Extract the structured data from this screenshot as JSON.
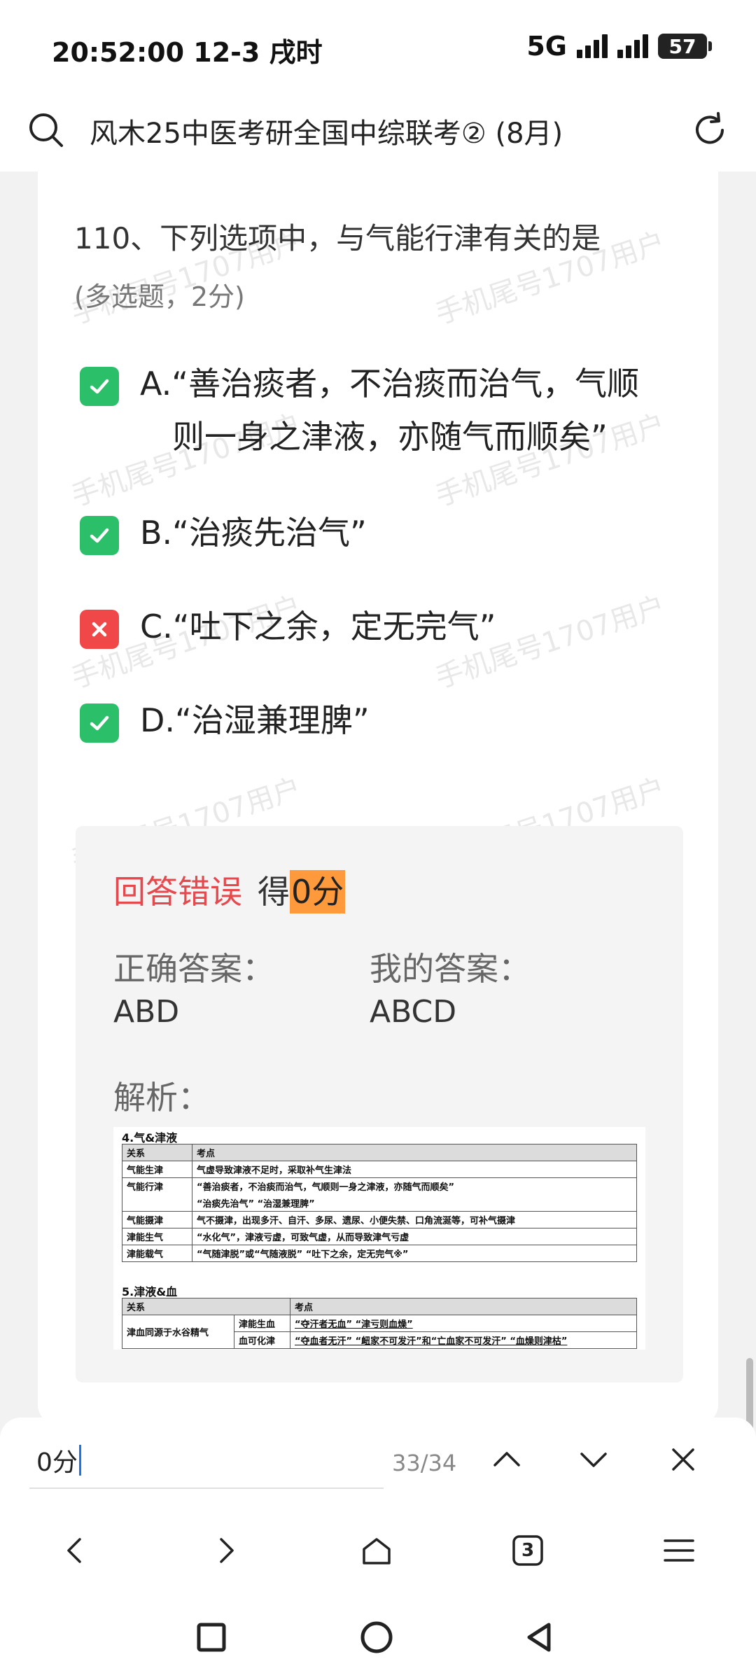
{
  "status_bar": {
    "time": "20:52:00 12-3 戌时",
    "network": "5G",
    "battery": "57"
  },
  "top_bar": {
    "title": "风木25中医考研全国中综联考② (8月)"
  },
  "watermark": "手机尾号1707用户",
  "question": {
    "title": "110、下列选项中，与气能行津有关的是",
    "subtitle": "(多选题，2分)",
    "options": [
      {
        "line1": "A.“善治痰者，不治痰而治气，气顺",
        "line2": "则一身之津液，亦随气而顺矣”",
        "state": "correct"
      },
      {
        "line1": "B.“治痰先治气”",
        "state": "correct"
      },
      {
        "line1": "C.“吐下之余，定无完气”",
        "state": "wrong"
      },
      {
        "line1": "D.“治湿兼理脾”",
        "state": "correct"
      }
    ]
  },
  "answer": {
    "status": "回答错误",
    "score_prefix": "得",
    "score_value": "0分",
    "correct_label": "正确答案：",
    "correct_value": "ABD",
    "mine_label": "我的答案：",
    "mine_value": "ABCD",
    "analysis_label": "解析："
  },
  "analysis_table": {
    "section1": "4.气&津液",
    "header": [
      "关系",
      "考点"
    ],
    "rows": [
      [
        "气能生津",
        "气虚导致津液不足时，采取补气生津法"
      ],
      [
        "气能行津",
        "“善治痰者，不治痰而治气，气顺则一身之津液，亦随气而顺矣”"
      ],
      [
        "",
        "“治痰先治气”  “治湿兼理脾”"
      ],
      [
        "气能摄津",
        "气不摄津，出现多汗、自汗、多尿、遗尿、小便失禁、口角流涎等，可补气摄津"
      ],
      [
        "津能生气",
        "“水化气”，津液亏虚，可致气虚，从而导致津气亏虚"
      ],
      [
        "津能载气",
        "“气随津脱”或“气随液脱”  “吐下之余，定无完气※”"
      ]
    ],
    "section2": "5.津液&血",
    "header2": [
      "关系",
      "考点"
    ],
    "group_label": "津血同源于水谷精气",
    "rows2": [
      [
        "津能生血",
        "“夺汗者无血”  “津亏则血燥”"
      ],
      [
        "血可化津",
        "“夺血者无汗”  “衄家不可发汗”和“亡血家不可发汗”  “血燥则津枯”"
      ]
    ]
  },
  "find_bar": {
    "query": "0分",
    "count": "33/34"
  },
  "browser_nav": {
    "tab_count": "3"
  }
}
